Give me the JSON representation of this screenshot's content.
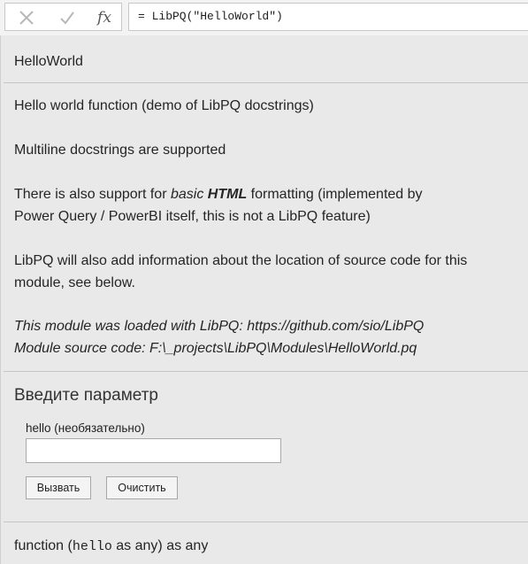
{
  "formula_bar": {
    "cancel_icon": "x-icon",
    "confirm_icon": "check-icon",
    "fx_label": "fx",
    "formula": "= LibPQ(\"HelloWorld\")"
  },
  "doc": {
    "name": "HelloWorld",
    "description": "Hello world function (demo of LibPQ docstrings)",
    "multiline_note": "Multiline docstrings are supported",
    "html_note": {
      "pre": "There is also support for ",
      "italic": "basic",
      "space": " ",
      "bold_italic": "HTML",
      "post": " formatting (implemented by",
      "line2": "Power Query / PowerBI itself, this is not a LibPQ feature)"
    },
    "source_note_line1": "LibPQ will also add information about the location of source code for this",
    "source_note_line2": "module, see below.",
    "loaded_with": "This module was loaded with LibPQ: https://github.com/sio/LibPQ",
    "source_code": "Module source code: F:\\_projects\\LibPQ\\Modules\\HelloWorld.pq"
  },
  "param_panel": {
    "heading": "Введите параметр",
    "param_label": "hello (необязательно)",
    "param_value": "",
    "invoke_label": "Вызвать",
    "clear_label": "Очистить"
  },
  "signature": {
    "prefix": "function (",
    "param": "hello",
    "suffix": " as any) as any"
  }
}
